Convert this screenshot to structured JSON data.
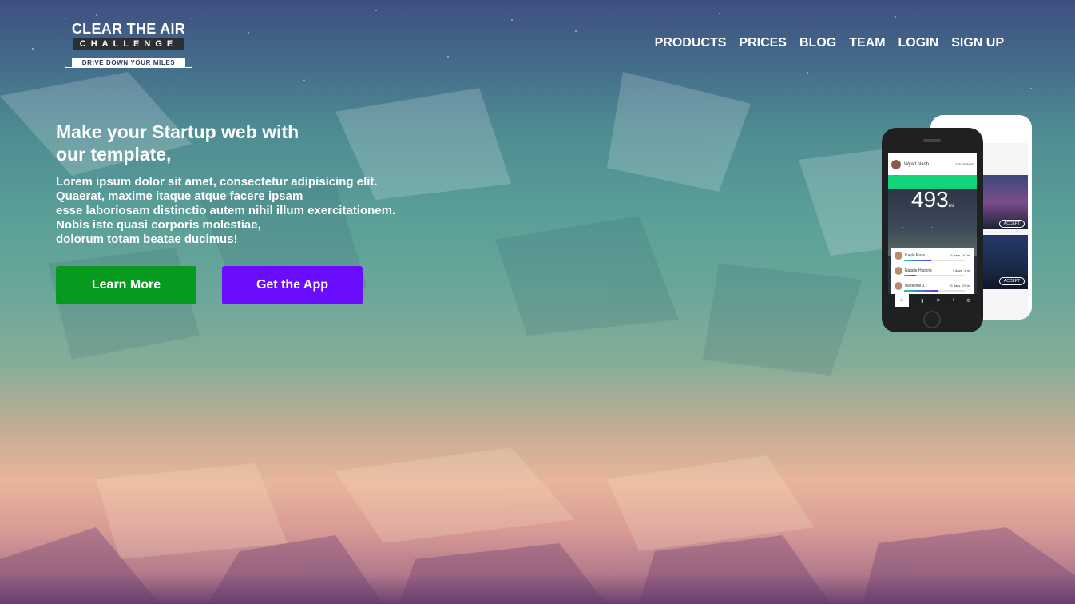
{
  "logo": {
    "line1": "CLEAR THE AIR",
    "line2": "CHALLENGE",
    "tagline": "DRIVE DOWN YOUR MILES"
  },
  "nav": {
    "items": [
      "PRODUCTS",
      "PRICES",
      "BLOG",
      "TEAM",
      "LOGIN",
      "SIGN UP"
    ]
  },
  "hero": {
    "title": "Make your Startup web with our template,",
    "text_lines": [
      "Lorem ipsum dolor sit amet, consectetur adipisicing elit.",
      "Quaerat, maxime itaque atque facere ipsam",
      "esse laboriosam distinctio autem nihil illum exercitationem.",
      "Nobis iste quasi corporis molestiae,",
      "dolorum totam beatae ducimus!"
    ]
  },
  "buttons": {
    "learn_more": "Learn More",
    "get_app": "Get the App"
  },
  "colors": {
    "learn_more_bg": "#069a1f",
    "get_app_bg": "#6a0dff",
    "app_green": "#13d37a"
  },
  "phone_app": {
    "user_name": "Wyatt Nash",
    "points": "745 POINTS",
    "miles": "493",
    "miles_unit": "mi",
    "leaderboard": [
      {
        "name": "Kayla Pass",
        "days": "5 days",
        "miles": "10 mi",
        "progress": 0.45
      },
      {
        "name": "Natalie Higgins",
        "days": "7 days",
        "miles": "8 mi",
        "progress": 0.2
      },
      {
        "name": "Madeline J.",
        "days": "15 days",
        "miles": "25 mi",
        "progress": 0.55
      }
    ],
    "accept_label": "ACCEPT"
  }
}
